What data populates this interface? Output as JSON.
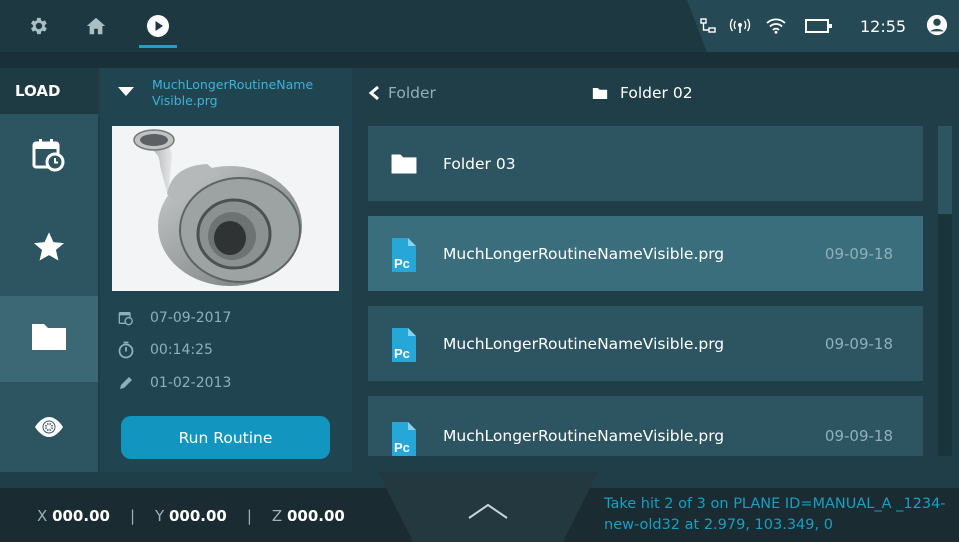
{
  "topbar": {
    "settings_icon": "gear-icon",
    "home_icon": "home-icon",
    "play_icon": "play-circle-icon",
    "time": "12:55"
  },
  "nav": {
    "load_label": "LOAD",
    "items": [
      {
        "icon": "calendar-clock-icon"
      },
      {
        "icon": "star-icon"
      },
      {
        "icon": "folder-icon",
        "active": true
      },
      {
        "icon": "eye-icon"
      }
    ]
  },
  "preview": {
    "routine_name": "MuchLongerRoutineName Visible.prg",
    "date": "07-09-2017",
    "duration": "00:14:25",
    "edited": "01-02-2013",
    "run_label": "Run Routine"
  },
  "browser": {
    "back_label": "Folder",
    "current_folder": "Folder 02",
    "rows": [
      {
        "type": "folder",
        "name": "Folder 03",
        "date": ""
      },
      {
        "type": "file",
        "name": "MuchLongerRoutineNameVisible.prg",
        "date": "09-09-18",
        "selected": true
      },
      {
        "type": "file",
        "name": "MuchLongerRoutineNameVisible.prg",
        "date": "09-09-18"
      },
      {
        "type": "file",
        "name": "MuchLongerRoutineNameVisible.prg",
        "date": "09-09-18"
      }
    ],
    "file_badge": "Pc"
  },
  "footer": {
    "x_label": "X",
    "x_value": "000.00",
    "y_label": "Y",
    "y_value": "000.00",
    "z_label": "Z",
    "z_value": "000.00",
    "sep": "|",
    "message": "Take  hit 2 of 3 on PLANE ID=MANUAL_A _1234-new-old32 at 2.979, 103.349, 0"
  },
  "colors": {
    "accent": "#18a4c8",
    "panel": "#2d5561",
    "selected_row": "#3a6e7c"
  }
}
